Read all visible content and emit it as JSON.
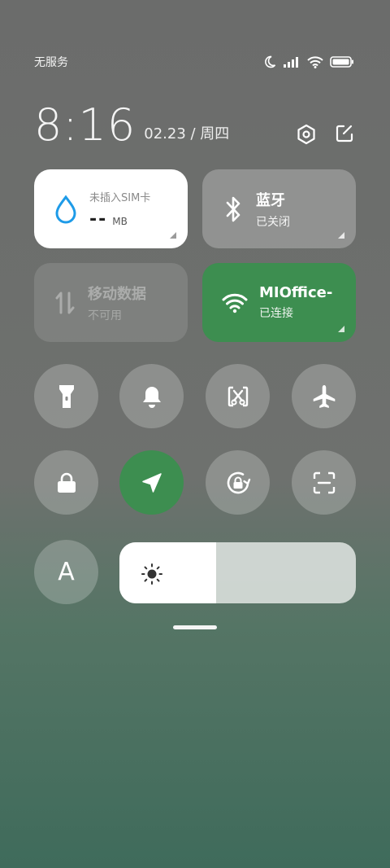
{
  "status": {
    "carrier": "无服务",
    "icons": [
      "moon-icon",
      "signal-icon",
      "wifi-icon",
      "battery-icon"
    ]
  },
  "header": {
    "time": "8:16",
    "date": "02.23 / 周四",
    "actions": [
      "settings-icon",
      "edit-icon"
    ]
  },
  "tiles": {
    "data": {
      "title": "未插入SIM卡",
      "value": "--",
      "unit": "MB",
      "icon": "water-drop-icon"
    },
    "bluetooth": {
      "title": "蓝牙",
      "subtitle": "已关闭",
      "icon": "bluetooth-icon"
    },
    "mobile": {
      "title": "移动数据",
      "subtitle": "不可用",
      "icon": "mobile-data-icon"
    },
    "wifi": {
      "title": "MIOffice-",
      "subtitle": "已连接",
      "icon": "wifi-icon"
    }
  },
  "toggles": [
    {
      "name": "flashlight",
      "icon": "flashlight-icon",
      "active": false
    },
    {
      "name": "sound",
      "icon": "bell-icon",
      "active": false
    },
    {
      "name": "screenshot",
      "icon": "screenshot-icon",
      "active": false
    },
    {
      "name": "airplane",
      "icon": "airplane-icon",
      "active": false
    },
    {
      "name": "lock-screen",
      "icon": "lock-icon",
      "active": false
    },
    {
      "name": "location",
      "icon": "location-arrow-icon",
      "active": true
    },
    {
      "name": "rotation-lock",
      "icon": "rotation-lock-icon",
      "active": false
    },
    {
      "name": "scanner",
      "icon": "scan-icon",
      "active": false
    }
  ],
  "font_button": {
    "label": "A"
  },
  "brightness": {
    "level": 0.41,
    "icon": "sun-icon"
  },
  "colors": {
    "active_green": "#3d8e50",
    "tile_white": "#ffffff",
    "accent_blue": "#1e9be8"
  }
}
